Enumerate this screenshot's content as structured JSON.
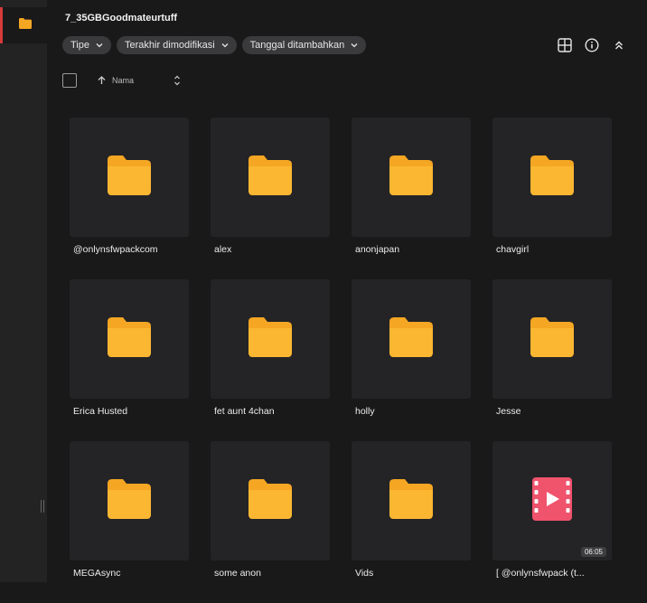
{
  "folder_title": "7_35GBGoodmateurtuff",
  "filters": [
    {
      "label": "Tipe"
    },
    {
      "label": "Terakhir dimodifikasi"
    },
    {
      "label": "Tanggal ditambahkan"
    }
  ],
  "sort": {
    "label": "Nama"
  },
  "items": [
    {
      "name": "@onlynsfwpackcom",
      "type": "folder"
    },
    {
      "name": "alex",
      "type": "folder"
    },
    {
      "name": "anonjapan",
      "type": "folder"
    },
    {
      "name": "chavgirl",
      "type": "folder"
    },
    {
      "name": "Erica Husted",
      "type": "folder"
    },
    {
      "name": "fet aunt 4chan",
      "type": "folder"
    },
    {
      "name": "holly",
      "type": "folder"
    },
    {
      "name": "Jesse",
      "type": "folder"
    },
    {
      "name": "MEGAsync",
      "type": "folder"
    },
    {
      "name": "some anon",
      "type": "folder"
    },
    {
      "name": "Vids",
      "type": "folder"
    },
    {
      "name": "[ @onlynsfwpack (t...",
      "type": "video",
      "duration": "06:05"
    }
  ],
  "colors": {
    "folder": "#f5a623",
    "video": "#f0536c",
    "accent": "#d63a3a"
  },
  "icons": {
    "rail": "folder-icon",
    "tools": [
      "grid-view-icon",
      "info-icon",
      "collapse-icon"
    ]
  }
}
